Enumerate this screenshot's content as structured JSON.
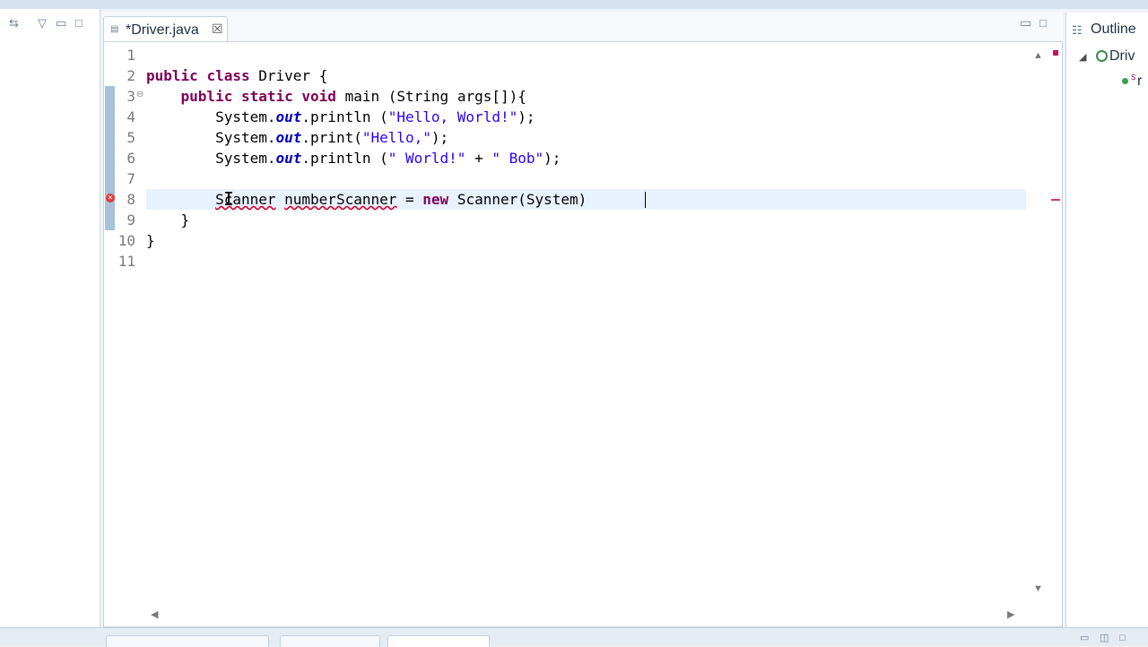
{
  "editor": {
    "tab_title": "*Driver.java",
    "close_glyph": "☒"
  },
  "code": {
    "lines": [
      "1",
      "2",
      "3",
      "4",
      "5",
      "6",
      "7",
      "8",
      "9",
      "10",
      "11"
    ],
    "class_kw": [
      "public",
      "class"
    ],
    "class_name": "Driver",
    "open_brace": "{",
    "main_kws": [
      "public",
      "static",
      "void"
    ],
    "main_sig": "main (String ",
    "main_param": "args",
    "main_sig_end": "[]){",
    "sys": "System.",
    "out": "out",
    "println": ".println (",
    "print": ".print(",
    "str_hello_world": "\"Hello, World!\"",
    "str_hello": "\"Hello,\"",
    "str_world": "\" World!\"",
    "str_bob": "\" Bob\"",
    "plus": " + ",
    "end_stmt": ");",
    "scanner_type": "Scanner",
    "scanner_var": "numberScanner",
    "assign": " = ",
    "new_kw": "new",
    "scanner_ctor": " Scanner(System)",
    "close_brace": "}"
  },
  "outline": {
    "title": "Outline",
    "class_label": "Driv",
    "method_label": "r",
    "static_mark": "S"
  },
  "icons": {
    "error": "error-icon",
    "fold": "collapse-icon"
  },
  "colors": {
    "keyword": "#7f0055",
    "string": "#2a00ff",
    "field": "#0000c0",
    "error": "#e23b3b",
    "current_line": "#e8f2fe"
  }
}
